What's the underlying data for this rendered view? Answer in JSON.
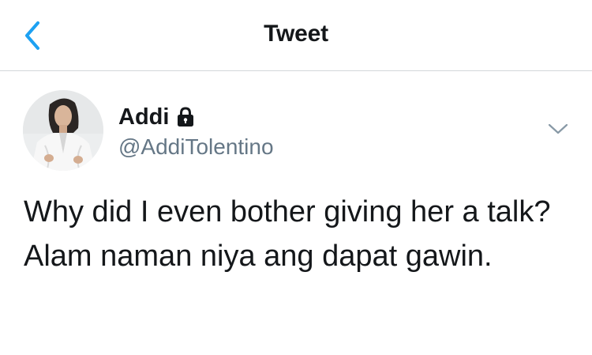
{
  "header": {
    "back_icon": "chevron-left-icon",
    "title": "Tweet"
  },
  "tweet": {
    "author": {
      "display_name": "Addi",
      "protected_icon": "lock-icon",
      "username": "@AddiTolentino"
    },
    "menu_icon": "chevron-down-icon",
    "text": "Why did I even bother giving her a talk? Alam naman niya ang dapat gawin."
  },
  "colors": {
    "accent": "#1da1f2",
    "text_primary": "#14171a",
    "text_secondary": "#657786",
    "divider": "#d3d7da"
  }
}
